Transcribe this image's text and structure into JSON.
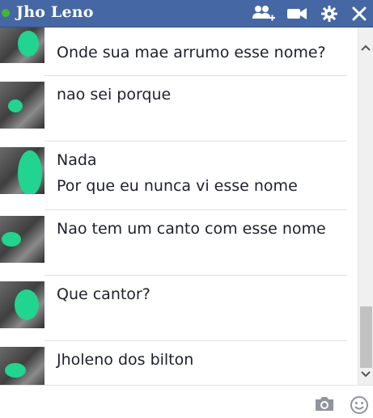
{
  "header": {
    "contact_name": "Jho Leno",
    "status": "online",
    "icons": [
      "add-friend-icon",
      "video-call-icon",
      "gear-icon",
      "close-icon"
    ]
  },
  "messages": [
    {
      "lines": [
        "Onde sua mae arrumo esse nome?"
      ]
    },
    {
      "lines": [
        "nao sei porque"
      ]
    },
    {
      "lines": [
        "Nada",
        "Por que eu nunca vi esse nome"
      ]
    },
    {
      "lines": [
        "Nao tem um canto com esse nome"
      ]
    },
    {
      "lines": [
        "Que cantor?"
      ]
    },
    {
      "lines": [
        "Jholeno dos bilton"
      ]
    }
  ],
  "composer": {
    "icons": [
      "camera-icon",
      "emoji-icon"
    ]
  },
  "colors": {
    "header_bg": "#4567a3",
    "status_online": "#42b72a",
    "avatar_scribble": "#21d48f"
  }
}
